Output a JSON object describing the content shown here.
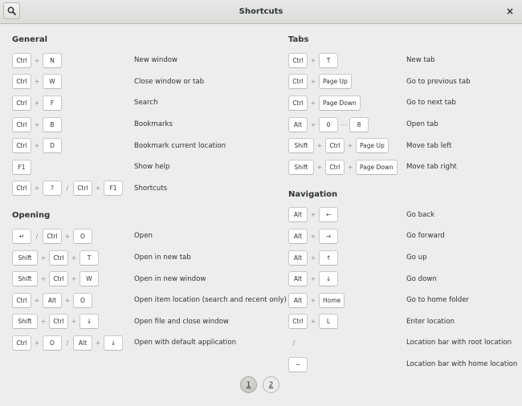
{
  "window": {
    "title": "Shortcuts",
    "close_glyph": "×"
  },
  "icons": {
    "search": "search-icon",
    "close": "close-icon"
  },
  "left_sections": [
    {
      "title": "General",
      "shortcuts": [
        {
          "keys": [
            "Ctrl",
            "+",
            "N"
          ],
          "label": "New window"
        },
        {
          "keys": [
            "Ctrl",
            "+",
            "W"
          ],
          "label": "Close window or tab"
        },
        {
          "keys": [
            "Ctrl",
            "+",
            "F"
          ],
          "label": "Search"
        },
        {
          "keys": [
            "Ctrl",
            "+",
            "B"
          ],
          "label": "Bookmarks"
        },
        {
          "keys": [
            "Ctrl",
            "+",
            "D"
          ],
          "label": "Bookmark current location"
        },
        {
          "keys": [
            "F1"
          ],
          "label": "Show help"
        },
        {
          "keys": [
            "Ctrl",
            "+",
            "?",
            "/",
            "Ctrl",
            "+",
            "F1"
          ],
          "label": "Shortcuts"
        }
      ]
    },
    {
      "title": "Opening",
      "shortcuts": [
        {
          "keys": [
            "↵",
            "/",
            "Ctrl",
            "+",
            "O"
          ],
          "label": "Open"
        },
        {
          "keys": [
            "Shift",
            "+",
            "Ctrl",
            "+",
            "T"
          ],
          "label": "Open in new tab"
        },
        {
          "keys": [
            "Shift",
            "+",
            "Ctrl",
            "+",
            "W"
          ],
          "label": "Open in new window"
        },
        {
          "keys": [
            "Ctrl",
            "+",
            "Alt",
            "+",
            "O"
          ],
          "label": "Open item location (search and recent only)"
        },
        {
          "keys": [
            "Shift",
            "+",
            "Ctrl",
            "+",
            "↓"
          ],
          "label": "Open file and close window"
        },
        {
          "keys": [
            "Ctrl",
            "+",
            "O",
            "/",
            "Alt",
            "+",
            "↓"
          ],
          "label": "Open with default application"
        }
      ]
    }
  ],
  "right_sections": [
    {
      "title": "Tabs",
      "shortcuts": [
        {
          "keys": [
            "Ctrl",
            "+",
            "T"
          ],
          "label": "New tab"
        },
        {
          "keys": [
            "Ctrl",
            "+",
            "Page Up"
          ],
          "label": "Go to previous tab"
        },
        {
          "keys": [
            "Ctrl",
            "+",
            "Page Down"
          ],
          "label": "Go to next tab"
        },
        {
          "keys": [
            "Alt",
            "+",
            "0",
            "⋯",
            "8"
          ],
          "label": "Open tab"
        },
        {
          "keys": [
            "Shift",
            "+",
            "Ctrl",
            "+",
            "Page Up"
          ],
          "label": "Move tab left"
        },
        {
          "keys": [
            "Shift",
            "+",
            "Ctrl",
            "+",
            "Page Down"
          ],
          "label": "Move tab right"
        }
      ]
    },
    {
      "title": "Navigation",
      "shortcuts": [
        {
          "keys": [
            "Alt",
            "+",
            "←"
          ],
          "label": "Go back"
        },
        {
          "keys": [
            "Alt",
            "+",
            "→"
          ],
          "label": "Go forward"
        },
        {
          "keys": [
            "Alt",
            "+",
            "↑"
          ],
          "label": "Go up"
        },
        {
          "keys": [
            "Alt",
            "+",
            "↓"
          ],
          "label": "Go down"
        },
        {
          "keys": [
            "Alt",
            "+",
            "Home"
          ],
          "label": "Go to home folder"
        },
        {
          "keys": [
            "Ctrl",
            "+",
            "L"
          ],
          "label": "Enter location"
        },
        {
          "keys": [
            "/"
          ],
          "label": "Location bar with root location"
        },
        {
          "keys": [
            "~"
          ],
          "label": "Location bar with home location"
        }
      ]
    }
  ],
  "pager": {
    "pages": [
      "1",
      "2"
    ],
    "active_page": "1"
  }
}
